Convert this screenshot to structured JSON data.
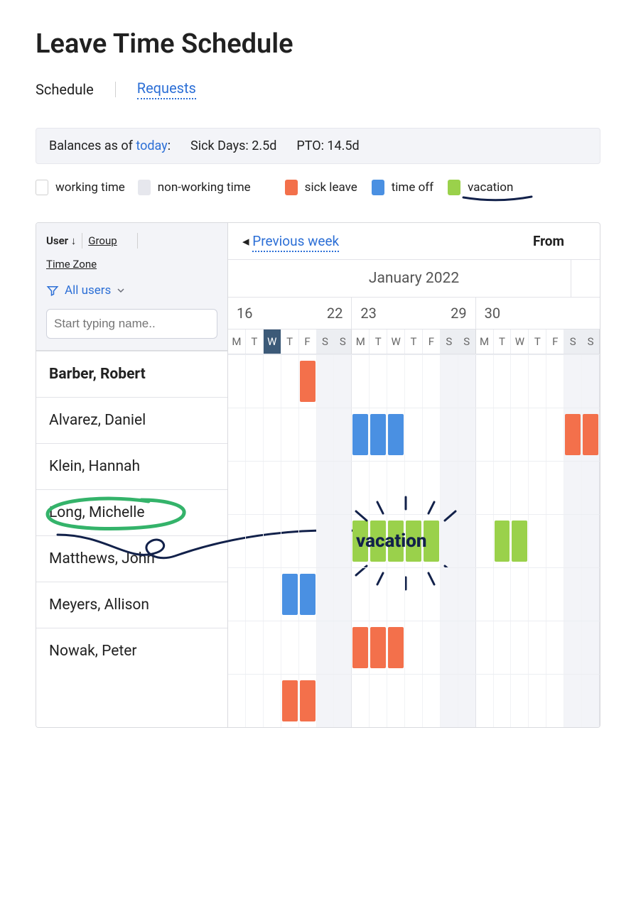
{
  "title": "Leave Time Schedule",
  "tabs": {
    "schedule": "Schedule",
    "requests": "Requests"
  },
  "balances": {
    "prefix": "Balances as of ",
    "link": "today",
    "suffix": ":",
    "sick": "Sick Days: 2.5d",
    "pto": "PTO: 14.5d"
  },
  "legend": {
    "working": "working time",
    "nonworking": "non-working time",
    "sick": "sick leave",
    "timeoff": "time off",
    "vacation": "vacation"
  },
  "side": {
    "user": "User",
    "group": "Group",
    "timezone": "Time Zone",
    "filter": "All users",
    "search_placeholder": "Start typing name.."
  },
  "nav": {
    "prev": "Previous week",
    "from": "From"
  },
  "month": "January 2022",
  "week_ranges": [
    {
      "start": "16",
      "end": "22"
    },
    {
      "start": "23",
      "end": "29"
    },
    {
      "start": "30",
      "end": ""
    }
  ],
  "dow": [
    "M",
    "T",
    "W",
    "T",
    "F",
    "S",
    "S",
    "M",
    "T",
    "W",
    "T",
    "F",
    "S",
    "S",
    "M",
    "T",
    "W",
    "T",
    "F",
    "S",
    "S"
  ],
  "today_index": 2,
  "weekend_indices": [
    5,
    6,
    12,
    13,
    19,
    20
  ],
  "users": [
    {
      "name": "Barber, Robert",
      "bold": true
    },
    {
      "name": "Alvarez, Daniel"
    },
    {
      "name": "Klein, Hannah"
    },
    {
      "name": "Long, Michelle",
      "circled": true
    },
    {
      "name": "Matthews, John"
    },
    {
      "name": "Meyers, Allison"
    },
    {
      "name": "Nowak, Peter"
    }
  ],
  "schedule": [
    [
      {
        "i": 4,
        "t": "sick"
      }
    ],
    [
      {
        "i": 7,
        "t": "timeoff"
      },
      {
        "i": 8,
        "t": "timeoff"
      },
      {
        "i": 9,
        "t": "timeoff"
      },
      {
        "i": 19,
        "t": "sick"
      },
      {
        "i": 20,
        "t": "sick"
      }
    ],
    [],
    [
      {
        "i": 7,
        "t": "vacation"
      },
      {
        "i": 8,
        "t": "vacation"
      },
      {
        "i": 9,
        "t": "vacation"
      },
      {
        "i": 10,
        "t": "vacation"
      },
      {
        "i": 11,
        "t": "vacation"
      },
      {
        "i": 15,
        "t": "vacation"
      },
      {
        "i": 16,
        "t": "vacation"
      }
    ],
    [
      {
        "i": 3,
        "t": "timeoff"
      },
      {
        "i": 4,
        "t": "timeoff"
      }
    ],
    [
      {
        "i": 7,
        "t": "sick"
      },
      {
        "i": 8,
        "t": "sick"
      },
      {
        "i": 9,
        "t": "sick"
      }
    ],
    [
      {
        "i": 3,
        "t": "sick"
      },
      {
        "i": 4,
        "t": "sick"
      }
    ]
  ],
  "annotation_label": "vacation"
}
